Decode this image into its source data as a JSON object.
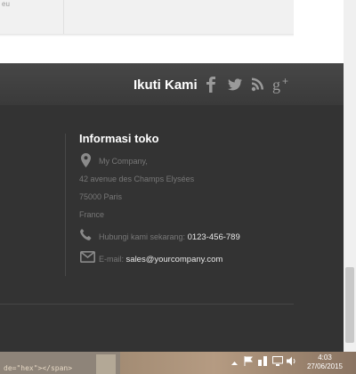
{
  "top": {
    "snippet": "eu"
  },
  "social": {
    "title": "Ikuti Kami",
    "icons": [
      "facebook-icon",
      "twitter-icon",
      "rss-icon",
      "google-plus-icon"
    ],
    "icon_color": "#9a9a9a"
  },
  "store_info": {
    "title": "Informasi toko",
    "address_lines": [
      "My Company,",
      "42 avenue des Champs Elysées",
      "75000 Paris",
      "France"
    ],
    "phone_label": "Hubungi kami sekarang:",
    "phone": "0123-456-789",
    "email_label": "E-mail:",
    "email": "sales@yourcompany.com"
  },
  "taskbar": {
    "code_snippet": "de=\"hex\"></span>",
    "time": "4:03",
    "date": "27/06/2015",
    "tray_icons": [
      "chevron-up-icon",
      "flag-icon",
      "network-icon",
      "volume-icon",
      "display-icon"
    ]
  },
  "colors": {
    "footer_bg": "#333333",
    "footer_band": "#424242",
    "text_muted": "#777777",
    "text_value": "#e8e8e8"
  }
}
